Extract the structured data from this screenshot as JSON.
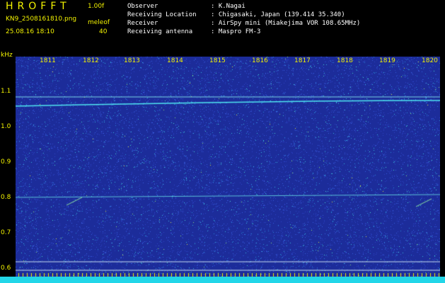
{
  "header": {
    "logo": "HROFFT",
    "version": "1.00f",
    "filename": "KN9_2508161810.png",
    "mode": "meleof",
    "datetime": "25.08.16 18:10",
    "number": "40"
  },
  "info": [
    {
      "key": "Observer",
      "value": ": K.Nagai"
    },
    {
      "key": "Receiving Location",
      "value": ": Chigasaki, Japan (139.414 35.340)"
    },
    {
      "key": "Receiver",
      "value": ": AirSpy mini (Miakejima VOR 108.65MHz)"
    },
    {
      "key": "Receiving antenna",
      "value": ": Maspro FM-3"
    }
  ],
  "axis": {
    "unit": "kHz",
    "x_ticks": [
      "1811",
      "1812",
      "1813",
      "1814",
      "1815",
      "1816",
      "1817",
      "1818",
      "1819",
      "1820"
    ],
    "y_ticks": [
      "1.1",
      "1.0",
      "0.9",
      "0.8",
      "0.7",
      "0.6"
    ]
  },
  "colors": {
    "background": "#1c2c9a",
    "label": "#f2f200",
    "trace": "#4fe6f0",
    "bottom_bar": "#22d6e8"
  }
}
